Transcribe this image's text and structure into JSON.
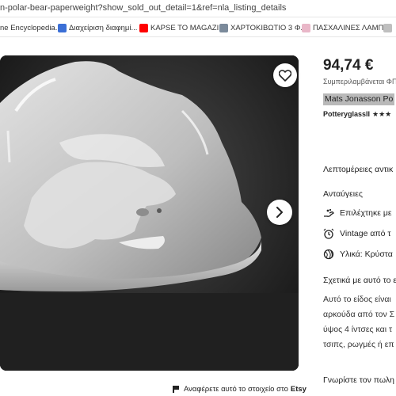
{
  "browser": {
    "url_text": "n-polar-bear-paperweight?show_sold_out_detail=1&ref=nla_listing_details"
  },
  "bookmarks": [
    {
      "label": "ne Encyclopedia...",
      "icon": "globe-icon"
    },
    {
      "label": "Διαχείριση διαφημί...",
      "icon": "edit-icon"
    },
    {
      "label": "KAPSE TO MAGAZI...",
      "icon": "youtube-icon"
    },
    {
      "label": "ΧΑΡΤΟΚΙΒΩΤΙΟ 3 Φ...",
      "icon": "folder-icon"
    },
    {
      "label": "ΠΑΣΧΑΛΙΝΕΣ ΛΑΜΠ...",
      "icon": "pink-circle-icon"
    },
    {
      "label": "",
      "icon": "bookmark-icon"
    }
  ],
  "listing": {
    "price": "94,74 €",
    "tax_note": "Συμπεριλαμβάνεται ΦΠ",
    "title": "Mats Jonasson Po",
    "shop_name": "PotteryglassII",
    "rating_stars": "★★★",
    "details_heading": "Λεπτομέρειες αντικ",
    "features_heading": "Ανταύγειες",
    "features": [
      {
        "icon": "hand-icon",
        "text": "Επιλέχτηκε με"
      },
      {
        "icon": "alarm-clock-icon",
        "text": "Vintage από τ"
      },
      {
        "icon": "yarn-ball-icon",
        "text": "Υλικά: Κρύστα"
      }
    ],
    "about_heading": "Σχετικά με αυτό το ε",
    "description_lines": [
      "Αυτό το είδος είναι",
      "αρκούδα από τον Σ",
      "ύψος 4 ίντσες και τ",
      "τσιπς, ρωγμές ή επ"
    ],
    "seller_heading": "Γνωρίστε τον πωλη",
    "report_text": "Αναφέρετε αυτό το στοιχείο στο",
    "report_brand": "Etsy"
  },
  "colors": {
    "accent_text": "#222222",
    "highlight": "#b9b9b9",
    "photo_background": "#1b1b1b"
  }
}
